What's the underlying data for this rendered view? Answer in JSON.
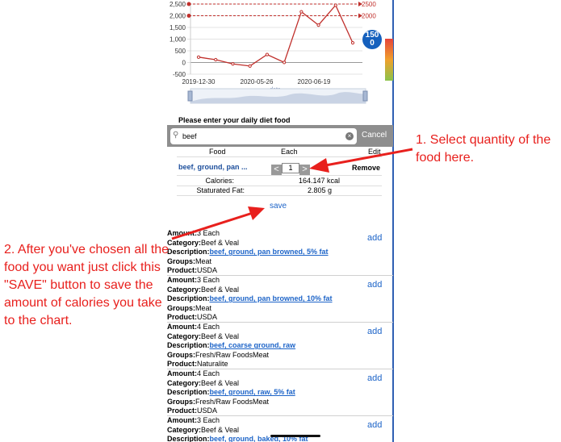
{
  "chart_data": {
    "type": "line",
    "y_ticks": [
      "2,500",
      "2,000",
      "1,500",
      "1,000",
      "500",
      "0",
      "-500"
    ],
    "y_range": [
      -500,
      2500
    ],
    "x_ticks": [
      "2019-12-30",
      "2020-05-26",
      "2020-06-19"
    ],
    "x_axis_name": "date",
    "reference_lines": [
      {
        "label": "2500",
        "value": 2500
      },
      {
        "label": "2000",
        "value": 2000
      }
    ],
    "series": [
      {
        "color": "#c0302c",
        "values": [
          230,
          120,
          -60,
          -150,
          340,
          5,
          2170,
          1600,
          2450,
          840
        ]
      }
    ],
    "badge_text": "150\n0",
    "colors": {
      "line": "#c0302c",
      "badge": "#1560bd"
    }
  },
  "diet": {
    "section_title": "Please enter your daily diet food",
    "search": {
      "value": "beef",
      "placeholder": "Search",
      "cancel_label": "Cancel"
    },
    "columns": {
      "food": "Food",
      "each": "Each",
      "edit": "Edit"
    },
    "entry": {
      "name": "beef, ground, pan ...",
      "quantity": "1",
      "decrement": "<",
      "increment": ">",
      "remove_label": "Remove"
    },
    "nutrition": [
      {
        "label": "Calories:",
        "value": "164.147 kcal"
      },
      {
        "label": "Staturated Fat:",
        "value": "2.805 g"
      }
    ],
    "save_label": "save"
  },
  "results": [
    {
      "amount": "3 Each",
      "category": "Beef & Veal",
      "description": "beef, ground, pan browned, 5% fat",
      "groups": "Meat",
      "product": "USDA"
    },
    {
      "amount": "3 Each",
      "category": "Beef & Veal",
      "description": "beef, ground, pan browned, 10% fat",
      "groups": "Meat",
      "product": "USDA"
    },
    {
      "amount": "4 Each",
      "category": "Beef & Veal",
      "description": "beef, coarse ground, raw",
      "groups": "Fresh/Raw FoodsMeat",
      "product": "Naturalite"
    },
    {
      "amount": "4 Each",
      "category": "Beef & Veal",
      "description": "beef, ground, raw, 5% fat",
      "groups": "Fresh/Raw FoodsMeat",
      "product": "USDA"
    },
    {
      "amount": "3 Each",
      "category": "Beef & Veal",
      "description": "beef, ground, baked, 10% fat",
      "groups": "",
      "product": ""
    }
  ],
  "labels": {
    "amount": "Amount:",
    "category": "Category:",
    "description": "Description:",
    "groups": "Groups:",
    "product": "Product:",
    "add": "add"
  },
  "annotations": {
    "callout_1": "1. Select quantity of the food here.",
    "callout_2": "2. After you've chosen all the food you want just click this \"SAVE\" button to save the amount of calories you take to the chart."
  }
}
